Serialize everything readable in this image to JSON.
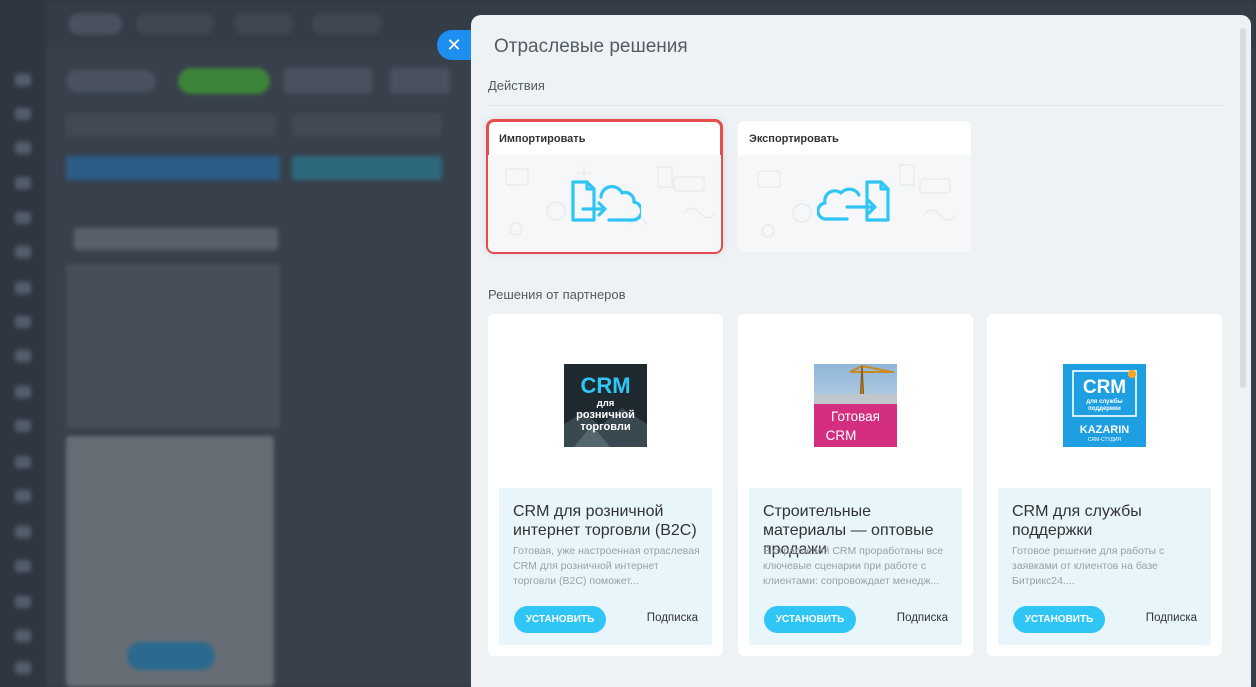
{
  "panel": {
    "title": "Отраслевые решения",
    "actions_label": "Действия",
    "partners_label": "Решения от партнеров"
  },
  "close_icon": "close-icon",
  "actions": [
    {
      "label": "Импортировать",
      "icon": "import-cloud-icon",
      "selected": true
    },
    {
      "label": "Экспортировать",
      "icon": "export-cloud-icon",
      "selected": false
    }
  ],
  "partners": [
    {
      "title": "CRM для розничной интернет торговли (B2C)",
      "description": "Готовая, уже настроенная отраслевая CRM для розничной интернет торговли (B2C) поможет...",
      "install_label": "УСТАНОВИТЬ",
      "subscription_label": "Подписка",
      "logo_lines": [
        "CRM",
        "для",
        "розничной",
        "торговли"
      ]
    },
    {
      "title": "Строительные материалы — оптовые продажи",
      "description": "В отраслевой CRM проработаны все ключевые сценарии при работе с клиентами: сопровождает менедж...",
      "install_label": "УСТАНОВИТЬ",
      "subscription_label": "Подписка",
      "logo_lines": [
        "Готовая",
        "CRM"
      ]
    },
    {
      "title": "CRM для службы поддержки",
      "description": "Готовое решение для работы с заявками от клиентов на базе Битрикс24....",
      "install_label": "УСТАНОВИТЬ",
      "subscription_label": "Подписка",
      "logo_lines": [
        "CRM",
        "для службы",
        "поддержки",
        "KAZARIN",
        "CRM-СТУДИЯ"
      ]
    }
  ],
  "colors": {
    "accent": "#2fc6f6",
    "close": "#1f8ef1",
    "selected_outline": "#e64c4c"
  }
}
